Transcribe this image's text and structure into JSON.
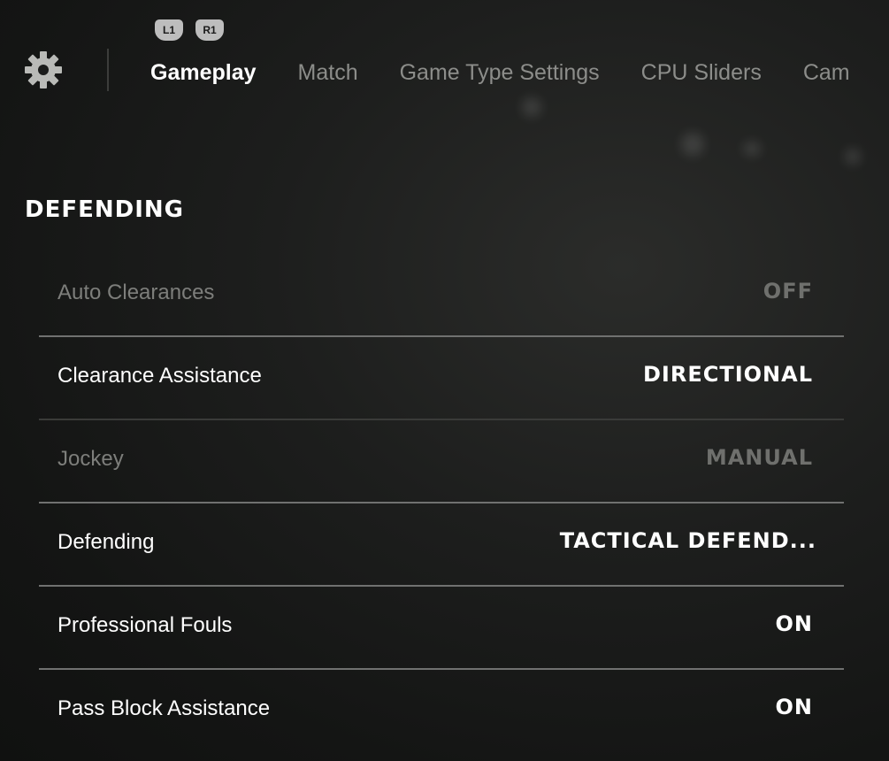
{
  "bumpers": {
    "left": "L1",
    "right": "R1"
  },
  "tabs": [
    {
      "label": "Gameplay",
      "active": true
    },
    {
      "label": "Match",
      "active": false
    },
    {
      "label": "Game Type Settings",
      "active": false
    },
    {
      "label": "CPU Sliders",
      "active": false
    },
    {
      "label": "Cam",
      "active": false
    }
  ],
  "section": {
    "title": "DEFENDING"
  },
  "settings": [
    {
      "label": "Auto Clearances",
      "value": "OFF",
      "enabled": false
    },
    {
      "label": "Clearance Assistance",
      "value": "DIRECTIONAL",
      "enabled": true
    },
    {
      "label": "Jockey",
      "value": "MANUAL",
      "enabled": false
    },
    {
      "label": "Defending",
      "value": "TACTICAL DEFEND...",
      "enabled": true
    },
    {
      "label": "Professional Fouls",
      "value": "ON",
      "enabled": true
    },
    {
      "label": "Pass Block Assistance",
      "value": "ON",
      "enabled": true
    }
  ],
  "icons": {
    "settings": "gear-icon"
  }
}
